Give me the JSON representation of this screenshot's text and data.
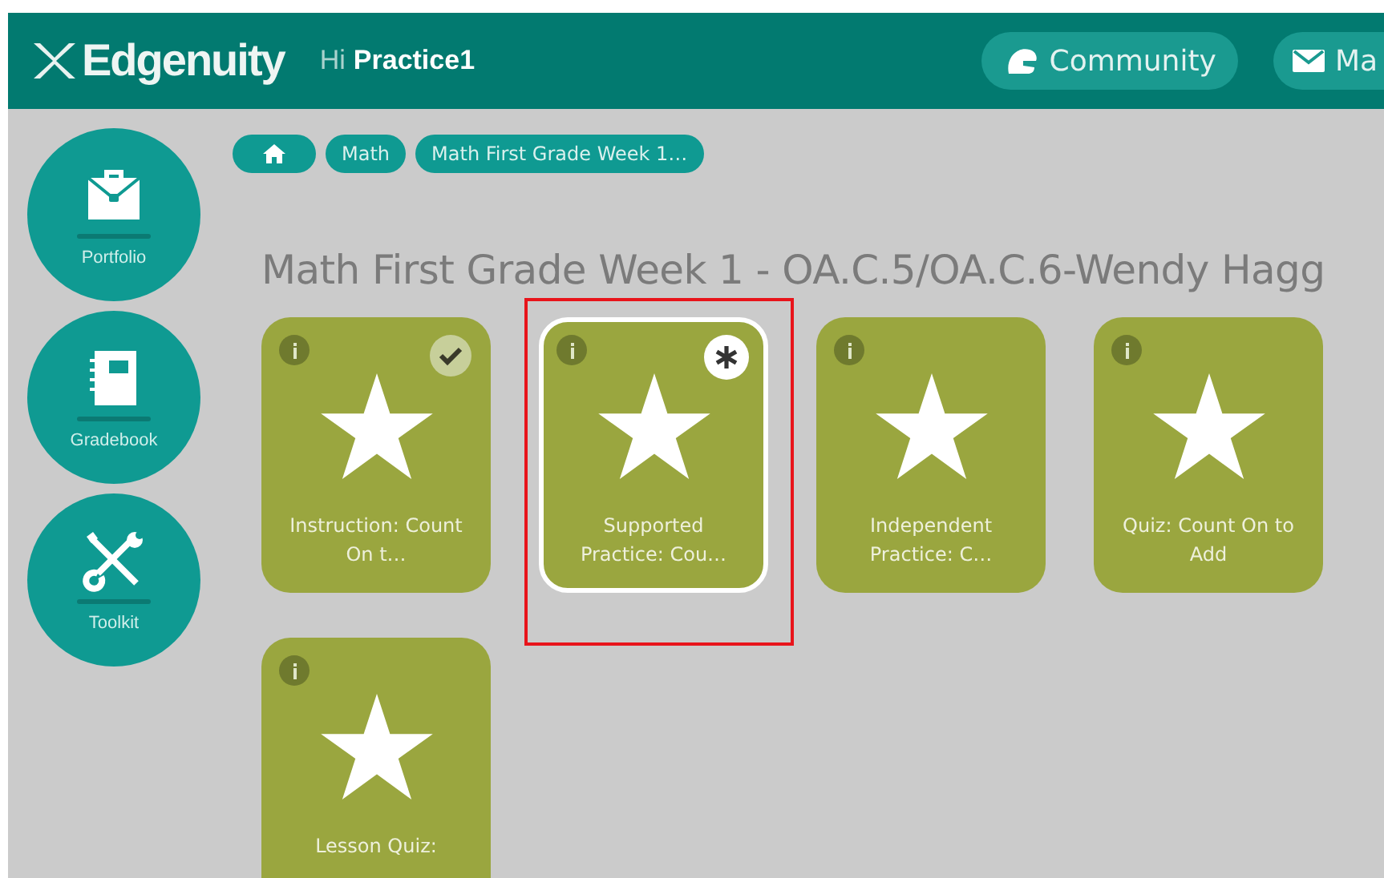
{
  "header": {
    "logo": "Edgenuity",
    "greeting": "Hi",
    "user": "Practice1",
    "buttons": [
      {
        "kind": "community",
        "label": "Community"
      },
      {
        "kind": "mail",
        "label": "Ma"
      }
    ]
  },
  "sidebar": {
    "items": [
      {
        "kind": "portfolio",
        "label": "Portfolio"
      },
      {
        "kind": "gradebook",
        "label": "Gradebook"
      },
      {
        "kind": "toolkit",
        "label": "Toolkit"
      }
    ]
  },
  "breadcrumbs": [
    {
      "kind": "home"
    },
    {
      "kind": "text",
      "label": "Math"
    },
    {
      "kind": "text",
      "label": "Math First Grade Week 1…"
    }
  ],
  "title": "Math First Grade Week 1 - OA.C.5/OA.C.6-Wendy Hagg",
  "cards": [
    {
      "label": "Instruction: Count On t…",
      "completed": true,
      "current": false,
      "selected": false
    },
    {
      "label": "Supported Practice: Cou…",
      "completed": false,
      "current": true,
      "selected": true
    },
    {
      "label": "Independent Practice: C…",
      "completed": false,
      "current": false,
      "selected": false
    },
    {
      "label": "Quiz: Count On to Add",
      "completed": false,
      "current": false,
      "selected": false
    },
    {
      "label": "Lesson Quiz:",
      "completed": false,
      "current": false,
      "selected": false
    }
  ]
}
